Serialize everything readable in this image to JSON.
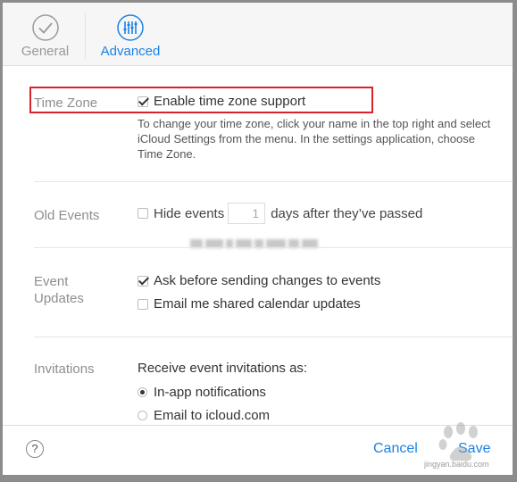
{
  "tabs": {
    "general": {
      "label": "General",
      "icon": "checkmark-circle-icon"
    },
    "advanced": {
      "label": "Advanced",
      "icon": "sliders-icon"
    }
  },
  "sections": {
    "time_zone": {
      "label": "Time Zone",
      "checkbox_label": "Enable time zone support",
      "checked": true,
      "description": "To change your time zone, click your name in the top right and select iCloud Settings from the menu. In the settings application, choose Time Zone."
    },
    "old_events": {
      "label": "Old Events",
      "checkbox_label": "Hide events",
      "checked": false,
      "days_value": "1",
      "suffix": "days after they’ve passed"
    },
    "event_updates": {
      "label_line1": "Event",
      "label_line2": "Updates",
      "options": [
        {
          "label": "Ask before sending changes to events",
          "checked": true
        },
        {
          "label": "Email me shared calendar updates",
          "checked": false
        }
      ]
    },
    "invitations": {
      "label": "Invitations",
      "prompt": "Receive event invitations as:",
      "options": [
        {
          "label": "In-app notifications",
          "selected": true
        },
        {
          "label": "Email to icloud.com",
          "selected": false
        }
      ]
    }
  },
  "footer": {
    "help_label": "?",
    "cancel_label": "Cancel",
    "save_label": "Save"
  },
  "watermark": {
    "text": "jingyan.baidu.com"
  },
  "colors": {
    "accent": "#1a82e6",
    "highlight": "#d9232b"
  }
}
